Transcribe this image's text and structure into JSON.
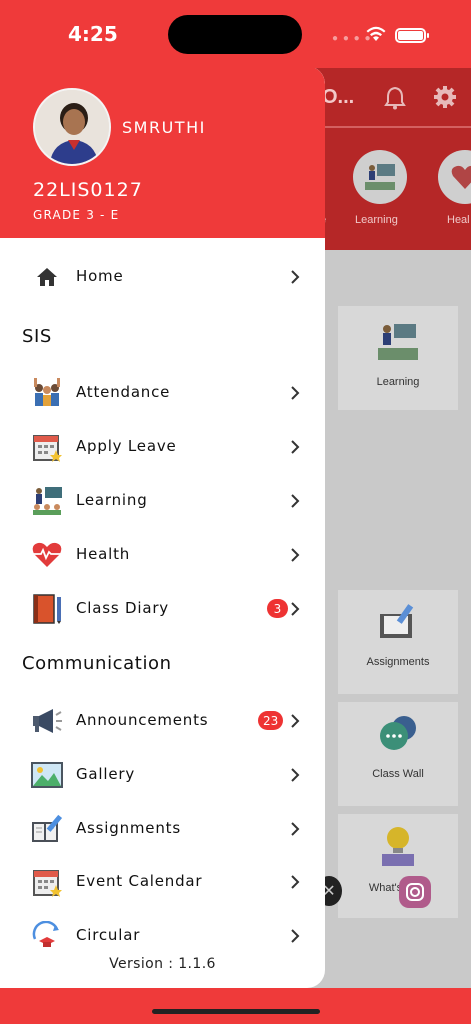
{
  "status_bar": {
    "time": "4:25"
  },
  "background": {
    "header_title": "O...",
    "quick_links": [
      {
        "label": "e"
      },
      {
        "label": "Learning"
      },
      {
        "label": "Heal"
      }
    ],
    "cards": [
      {
        "label": "Learning"
      },
      {
        "label": "Assignments"
      },
      {
        "label": "Class Wall"
      },
      {
        "label": "What's New"
      }
    ]
  },
  "profile": {
    "name": "SMRUTHI",
    "id": "22LIS0127",
    "grade": "GRADE 3 - E"
  },
  "menu": {
    "home": {
      "label": "Home",
      "icon": "home-icon"
    },
    "sis_title": "SIS",
    "sis_items": [
      {
        "label": "Attendance",
        "icon": "attendance-icon"
      },
      {
        "label": "Apply Leave",
        "icon": "apply-leave-icon"
      },
      {
        "label": "Learning",
        "icon": "learning-icon"
      },
      {
        "label": "Health",
        "icon": "health-icon"
      },
      {
        "label": "Class Diary",
        "icon": "class-diary-icon",
        "badge": "3"
      }
    ],
    "communication_title": "Communication",
    "communication_items": [
      {
        "label": "Announcements",
        "icon": "megaphone-icon",
        "badge": "23"
      },
      {
        "label": "Gallery",
        "icon": "gallery-icon"
      },
      {
        "label": "Assignments",
        "icon": "assignments-icon"
      },
      {
        "label": "Event Calendar",
        "icon": "calendar-icon"
      },
      {
        "label": "Circular",
        "icon": "circular-icon"
      }
    ]
  },
  "version": "Version : 1.1.6",
  "colors": {
    "primary": "#ef3a3a",
    "badge": "#ee3333"
  }
}
